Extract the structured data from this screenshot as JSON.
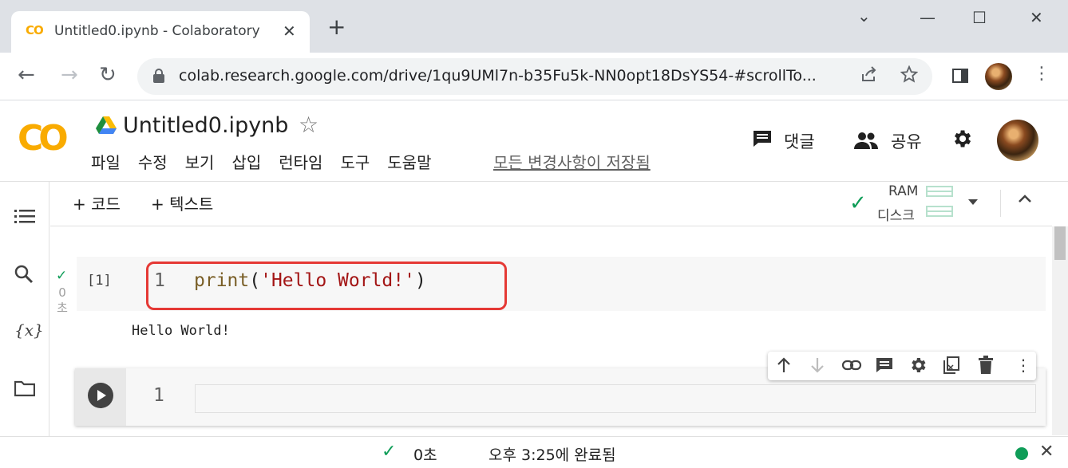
{
  "browser": {
    "tab_title": "Untitled0.ipynb - Colaboratory",
    "tab_logo": "CO",
    "tab_close": "✕",
    "new_tab": "+",
    "window_controls": {
      "minimize": "—",
      "maximize": "☐",
      "close": "✕",
      "dropdown": "⌄"
    },
    "url": "colab.research.google.com/drive/1qu9UMl7n-b35Fu5k-NN0opt18DsYS54-#scrollTo...",
    "nav": {
      "back": "←",
      "forward": "→",
      "reload": "↻"
    }
  },
  "colab": {
    "logo": "CO",
    "notebook_title": "Untitled0.ipynb",
    "menu": [
      "파일",
      "수정",
      "보기",
      "삽입",
      "런타임",
      "도구",
      "도움말"
    ],
    "save_status": "모든 변경사항이 저장됨",
    "comment_label": "댓글",
    "share_label": "공유"
  },
  "toolbar": {
    "add_code": "+ 코드",
    "add_text": "+ 텍스트",
    "ram_label": "RAM",
    "disk_label": "디스크"
  },
  "cells": [
    {
      "exec_count": "[1]",
      "exec_time_value": "0",
      "exec_time_unit": "초",
      "line_number": "1",
      "code_fn": "print",
      "code_open": "(",
      "code_string": "'Hello World!'",
      "code_close": ")",
      "output": "Hello World!"
    },
    {
      "line_number": "1",
      "code": ""
    }
  ],
  "status": {
    "duration": "0초",
    "completed": "오후 3:25에 완료됨"
  },
  "colors": {
    "accent_orange": "#f9ab00",
    "success_green": "#0f9d58",
    "highlight_red": "#e53935"
  }
}
